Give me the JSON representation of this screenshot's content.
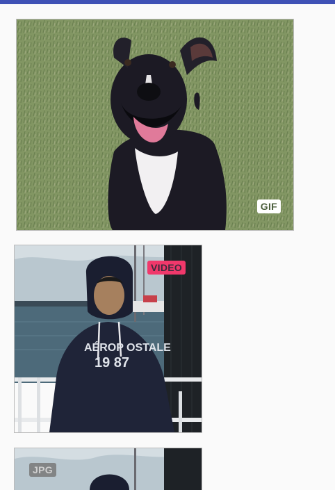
{
  "app_bar": {
    "color": "#3f51b5"
  },
  "feed": {
    "items": [
      {
        "subject": "black dog on grass",
        "badge": "GIF",
        "badge_color": "#ffffff"
      },
      {
        "subject": "man in navy hoodie by harbor",
        "badge": "VIDEO",
        "badge_color": "#f0386b"
      },
      {
        "subject": "man in navy hoodie by harbor",
        "badge": "JPG",
        "badge_color": "#7a7a7a"
      }
    ]
  }
}
